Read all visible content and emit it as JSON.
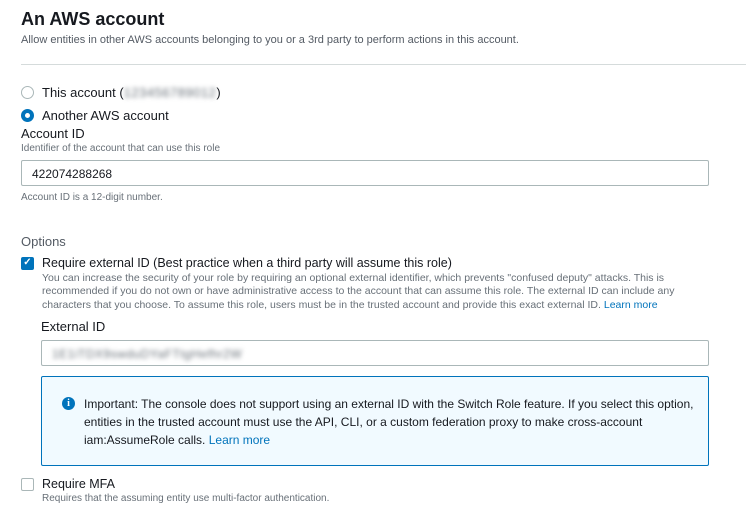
{
  "section": {
    "title": "An AWS account",
    "description": "Allow entities in other AWS accounts belonging to you or a 3rd party to perform actions in this account."
  },
  "account_choice": {
    "this_account_label": "This account (",
    "this_account_id_redacted": "123456789012",
    "this_account_suffix": ")",
    "this_account_selected": false,
    "another_account_label": "Another AWS account",
    "another_account_selected": true
  },
  "account_id": {
    "label": "Account ID",
    "hint": "Identifier of the account that can use this role",
    "value": "422074288268",
    "constraint": "Account ID is a 12-digit number."
  },
  "options": {
    "heading": "Options",
    "require_external_id": {
      "label": "Require external ID (Best practice when a third party will assume this role)",
      "checked": true,
      "description": "You can increase the security of your role by requiring an optional external identifier, which prevents \"confused deputy\" attacks. This is recommended if you do not own or have administrative access to the account that can assume this role. The external ID can include any characters that you choose. To assume this role, users must be in the trusted account and provide this exact external ID.",
      "learn_more": "Learn more"
    },
    "external_id": {
      "label": "External ID",
      "value_redacted": "1E1iTDX9swduDYaFTtgHefhr2W"
    },
    "alert": {
      "icon": "info-icon",
      "text": "Important: The console does not support using an external ID with the Switch Role feature. If you select this option, entities in the trusted account must use the API, CLI, or a custom federation proxy to make cross-account iam:AssumeRole calls.",
      "learn_more": "Learn more"
    },
    "require_mfa": {
      "label": "Require MFA",
      "checked": false,
      "description": "Requires that the assuming entity use multi-factor authentication."
    }
  },
  "colors": {
    "accent": "#0073bb",
    "alert_background": "#f1faff",
    "text_primary": "#16191f",
    "text_secondary": "#687078"
  }
}
